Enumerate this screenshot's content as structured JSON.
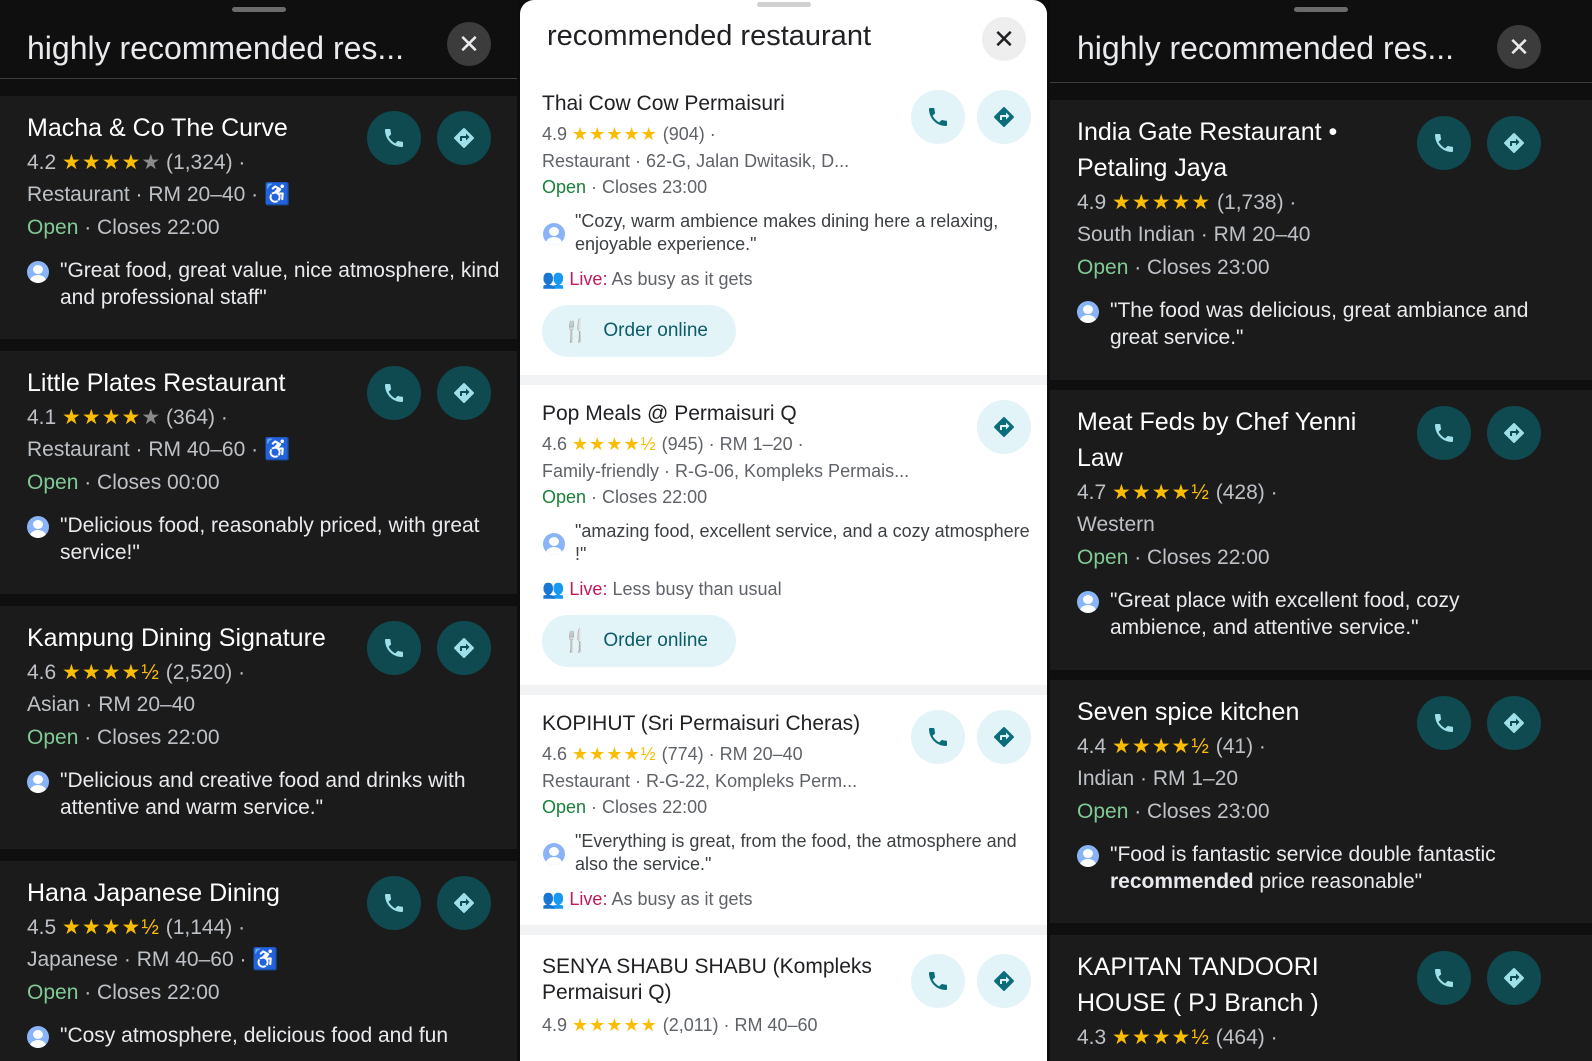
{
  "left": {
    "title": "highly recommended res...",
    "close": "✕",
    "cards": [
      {
        "name": "Macha & Co The Curve",
        "rating": "4.2",
        "stars": "★★★★",
        "empty": "★",
        "count": "(1,324) ·",
        "line2": "Restaurant · RM 20–40 ·",
        "access": "♿",
        "open": "Open",
        "hours": " · Closes 22:00",
        "review": "\"Great food, great value, nice atmosphere, kind and professional staff\""
      },
      {
        "name": "Little Plates Restaurant",
        "rating": "4.1",
        "stars": "★★★★",
        "empty": "★",
        "count": "(364) ·",
        "line2": "Restaurant · RM 40–60 ·",
        "access": "♿",
        "open": "Open",
        "hours": " · Closes 00:00",
        "review": "\"Delicious food, reasonably priced, with great service!\""
      },
      {
        "name": "Kampung Dining Signature",
        "rating": "4.6",
        "stars": "★★★★½",
        "empty": "",
        "count": "(2,520) ·",
        "line2": "Asian · RM 20–40",
        "access": "",
        "open": "Open",
        "hours": " · Closes 22:00",
        "review": "\"Delicious and creative food and drinks with attentive and warm service.\""
      },
      {
        "name": "Hana Japanese Dining",
        "rating": "4.5",
        "stars": "★★★★½",
        "empty": "",
        "count": "(1,144) ·",
        "line2": "Japanese · RM 40–60 ·",
        "access": "♿",
        "open": "Open",
        "hours": " · Closes 22:00",
        "review": "\"Cosy atmosphere, delicious food and fun"
      }
    ]
  },
  "middle": {
    "title": "recommended restaurant",
    "close": "✕",
    "cards": [
      {
        "name": "Thai Cow Cow Permaisuri",
        "rating": "4.9",
        "stars": "★★★★★",
        "count": "(904) ·",
        "line2": "Restaurant · 62-G, Jalan Dwitasik, D...",
        "open": "Open",
        "hours": " · Closes 23:00",
        "review": "\"Cozy, warm ambience makes dining here a relaxing, enjoyable experience.\"",
        "live_label": "Live:",
        "live_text": " As busy as it gets",
        "order": "Order online"
      },
      {
        "name": "Pop Meals @ Permaisuri Q",
        "rating": "4.6",
        "stars": "★★★★½",
        "count": "(945) · RM 1–20 ·",
        "line2": "Family-friendly · R-G-06, Kompleks Permais...",
        "open": "Open",
        "hours": " · Closes 22:00",
        "review": "\"amazing food, excellent service, and a cozy atmosphere !\"",
        "live_label": "Live:",
        "live_text": " Less busy than usual",
        "order": "Order online"
      },
      {
        "name": "KOPIHUT (Sri Permaisuri Cheras)",
        "rating": "4.6",
        "stars": "★★★★½",
        "count": "(774) · RM 20–40",
        "line2": "Restaurant · R-G-22, Kompleks Perm...",
        "open": "Open",
        "hours": " · Closes 22:00",
        "review": "\"Everything is great, from the food, the atmosphere and also the service.\"",
        "live_label": "Live:",
        "live_text": " As busy as it gets"
      },
      {
        "name": "SENYA SHABU SHABU (Kompleks",
        "name2": "Permaisuri Q)",
        "rating": "4.9",
        "stars": "★★★★★",
        "count": "(2,011) · RM 40–60"
      }
    ]
  },
  "right": {
    "title": "highly recommended res...",
    "close": "✕",
    "cards": [
      {
        "name": "India Gate Restaurant •",
        "name2": "Petaling Jaya",
        "rating": "4.9",
        "stars": "★★★★★",
        "count": "(1,738) ·",
        "line2": "South Indian · RM 20–40",
        "open": "Open",
        "hours": " · Closes 23:00",
        "review": "\"The food was delicious, great ambiance and great service.\""
      },
      {
        "name": "Meat Feds by Chef Yenni",
        "name2": "Law",
        "rating": "4.7",
        "stars": "★★★★½",
        "count": "(428) ·",
        "line2": "Western",
        "open": "Open",
        "hours": " · Closes 22:00",
        "review": "\"Great place with excellent food, cozy ambience, and attentive service.\""
      },
      {
        "name": "Seven spice kitchen",
        "rating": "4.4",
        "stars": "★★★★½",
        "count": "(41) ·",
        "line2": "Indian · RM 1–20",
        "open": "Open",
        "hours": " · Closes 23:00",
        "review_a": "\"Food is fantastic  service double fantastic ",
        "review_b": "recommended",
        "review_c": " price reasonable\""
      },
      {
        "name": "KAPITAN TANDOORI",
        "name2": "HOUSE ( PJ Branch )",
        "rating": "4.3",
        "stars": "★★★★½",
        "count": "(464) ·"
      }
    ]
  },
  "icons": {
    "phone": "phone-icon",
    "directions": "directions-icon",
    "avatar": "avatar-icon",
    "people": "people-icon",
    "fork": "fork-knife-icon"
  },
  "colors": {
    "accent_dark": "#0e4a4f",
    "accent_light": "#e3f4f8",
    "star": "#fbbc04",
    "open_dark": "#81c995",
    "open_light": "#188038",
    "live": "#c2185b"
  }
}
